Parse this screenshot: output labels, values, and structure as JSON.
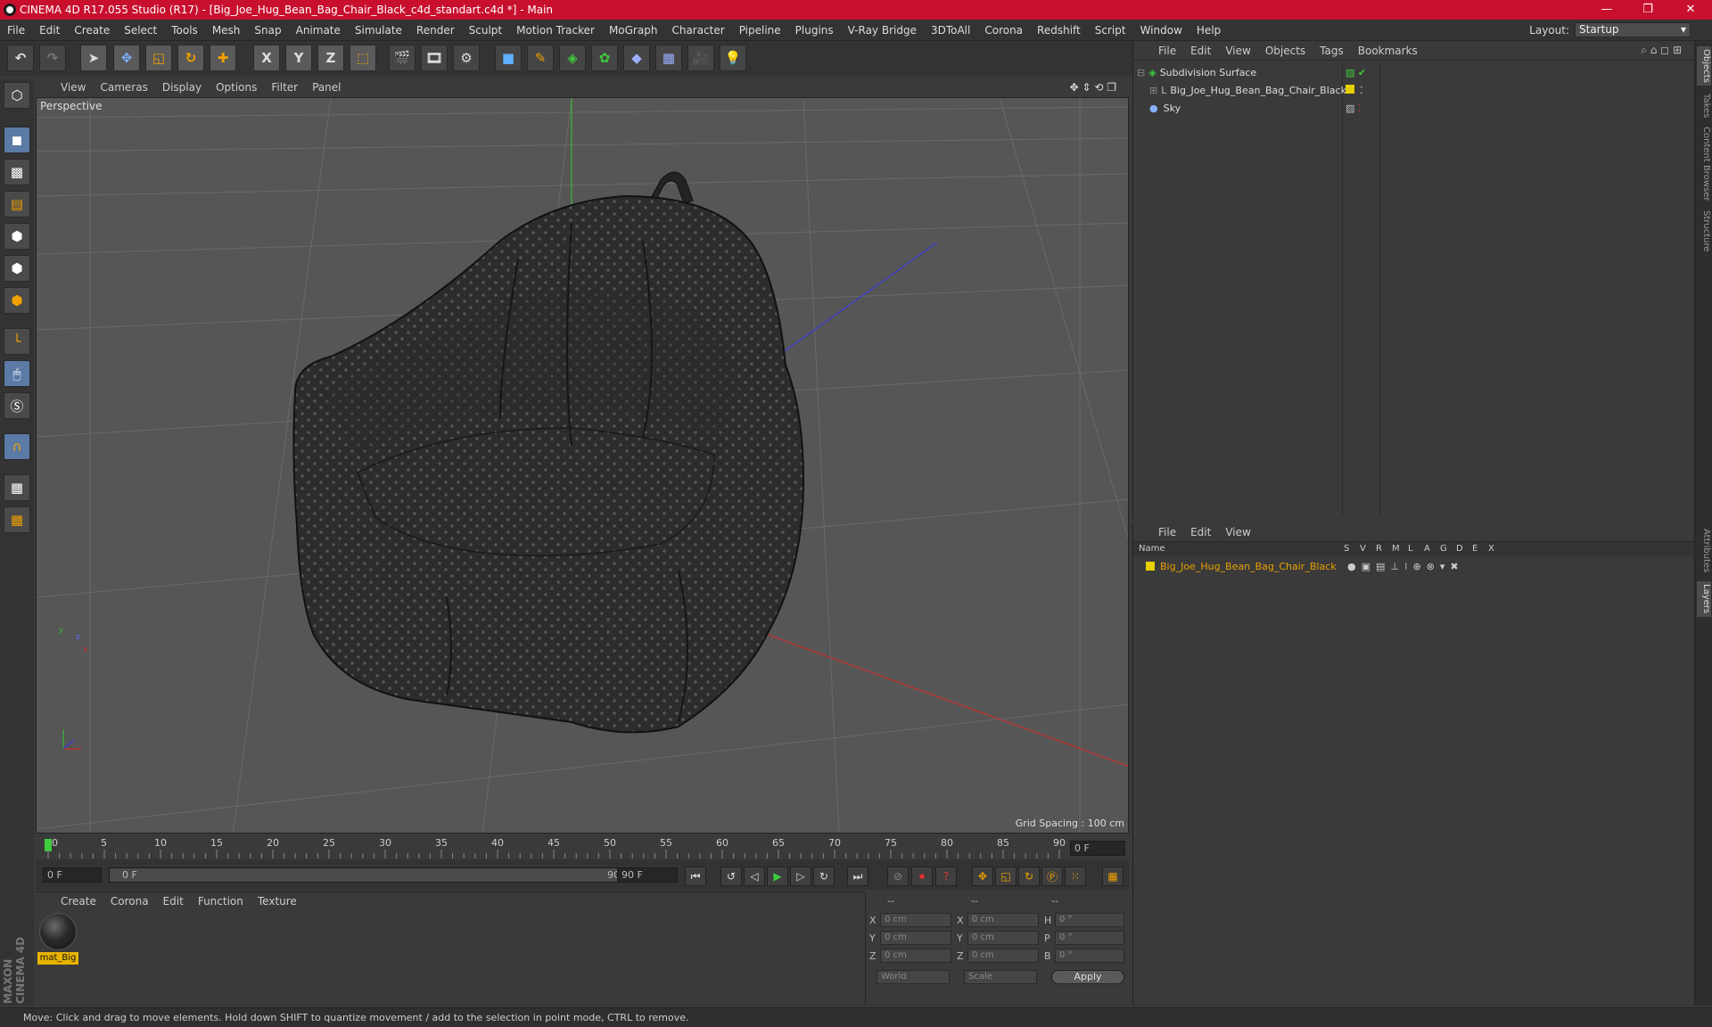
{
  "window": {
    "title": "CINEMA 4D R17.055 Studio (R17) - [Big_Joe_Hug_Bean_Bag_Chair_Black_c4d_standart.c4d *] - Main",
    "minimize": "—",
    "maximize": "❐",
    "close": "✕"
  },
  "menu": {
    "items": [
      "File",
      "Edit",
      "Create",
      "Select",
      "Tools",
      "Mesh",
      "Snap",
      "Animate",
      "Simulate",
      "Render",
      "Sculpt",
      "Motion Tracker",
      "MoGraph",
      "Character",
      "Pipeline",
      "Plugins",
      "V-Ray Bridge",
      "3DToAll",
      "Corona",
      "Redshift",
      "Script",
      "Window",
      "Help"
    ],
    "layout_label": "Layout:",
    "layout_value": "Startup"
  },
  "toolbar": {
    "x_label": "X",
    "y_label": "Y",
    "z_label": "Z"
  },
  "viewport": {
    "menu": [
      "View",
      "Cameras",
      "Display",
      "Options",
      "Filter",
      "Panel"
    ],
    "label": "Perspective",
    "grid_spacing": "Grid Spacing : 100 cm",
    "axis_x": "x",
    "axis_y": "y",
    "axis_z": "z"
  },
  "timeline": {
    "ticks": [
      "0",
      "5",
      "10",
      "15",
      "20",
      "25",
      "30",
      "35",
      "40",
      "45",
      "50",
      "55",
      "60",
      "65",
      "70",
      "75",
      "80",
      "85",
      "90"
    ],
    "current_frame_field": "0 F",
    "start_field": "0 F",
    "range_start": "0 F",
    "range_end": "90 F",
    "end_field": "90 F"
  },
  "materials": {
    "menu": [
      "Create",
      "Corona",
      "Edit",
      "Function",
      "Texture"
    ],
    "items": [
      {
        "name": "mat_Big"
      }
    ]
  },
  "coords": {
    "header1": "--",
    "header2": "--",
    "header3": "--",
    "rows": [
      {
        "l1": "X",
        "v1": "0 cm",
        "l2": "X",
        "v2": "0 cm",
        "l3": "H",
        "v3": "0 °"
      },
      {
        "l1": "Y",
        "v1": "0 cm",
        "l2": "Y",
        "v2": "0 cm",
        "l3": "P",
        "v3": "0 °"
      },
      {
        "l1": "Z",
        "v1": "0 cm",
        "l2": "Z",
        "v2": "0 cm",
        "l3": "B",
        "v3": "0 °"
      }
    ],
    "coord_system": "World",
    "mode": "Scale",
    "apply": "Apply"
  },
  "object_manager": {
    "menu": [
      "File",
      "Edit",
      "View",
      "Objects",
      "Tags",
      "Bookmarks"
    ],
    "objects": [
      {
        "name": "Subdivision Surface"
      },
      {
        "name": "Big_Joe_Hug_Bean_Bag_Chair_Black"
      },
      {
        "name": "Sky"
      }
    ]
  },
  "layer_manager": {
    "menu": [
      "File",
      "Edit",
      "View"
    ],
    "columns": [
      "Name",
      "S",
      "V",
      "R",
      "M",
      "L",
      "A",
      "G",
      "D",
      "E",
      "X"
    ],
    "layers": [
      {
        "name": "Big_Joe_Hug_Bean_Bag_Chair_Black"
      }
    ]
  },
  "right_tabs": [
    "Objects",
    "Takes",
    "Content Browser",
    "Structure",
    "Attributes",
    "Layers"
  ],
  "status": "Move: Click and drag to move elements. Hold down SHIFT to quantize movement / add to the selection in point mode, CTRL to remove.",
  "brand": "MAXON CINEMA 4D",
  "colors": {
    "titlebar": "#c8102e",
    "layer_name": "#e8a000",
    "selection_blue": "#5b7aa6",
    "play_green": "#3dcc3d"
  }
}
